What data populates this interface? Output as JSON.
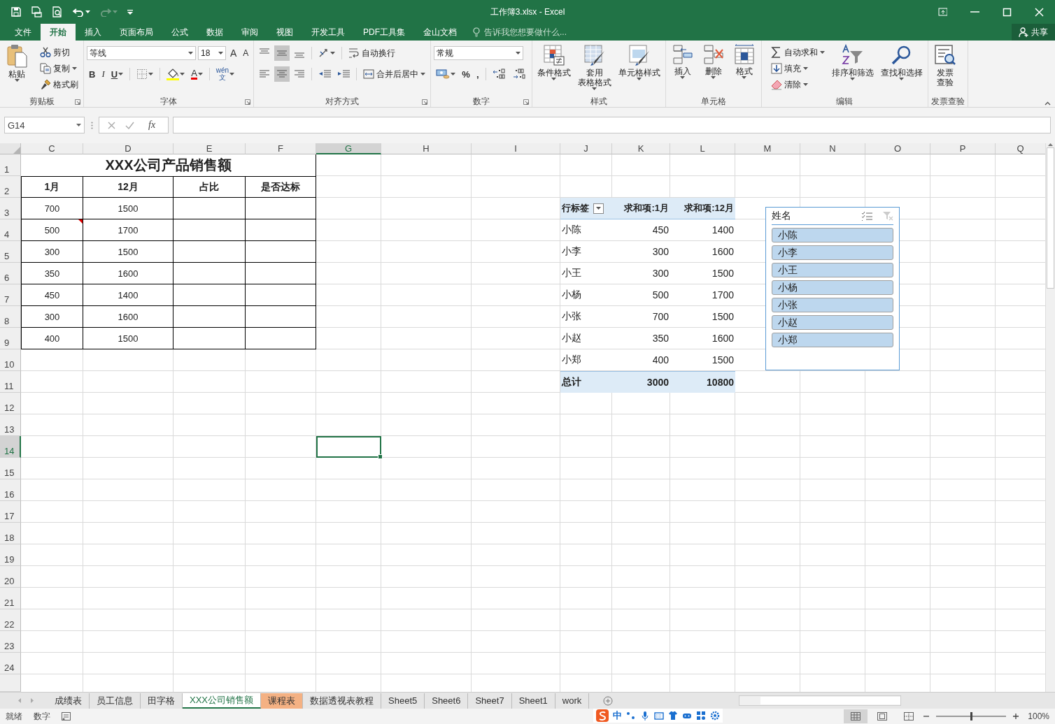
{
  "window": {
    "title": "工作簿3.xlsx - Excel"
  },
  "quick_access": {
    "redo_enabled": false
  },
  "menu_tabs": [
    {
      "label": "文件",
      "selected": false
    },
    {
      "label": "开始",
      "selected": true
    },
    {
      "label": "插入",
      "selected": false
    },
    {
      "label": "页面布局",
      "selected": false
    },
    {
      "label": "公式",
      "selected": false
    },
    {
      "label": "数据",
      "selected": false
    },
    {
      "label": "审阅",
      "selected": false
    },
    {
      "label": "视图",
      "selected": false
    },
    {
      "label": "开发工具",
      "selected": false
    },
    {
      "label": "PDF工具集",
      "selected": false
    },
    {
      "label": "金山文档",
      "selected": false
    }
  ],
  "tell_me": {
    "placeholder": "告诉我您想要做什么..."
  },
  "share": {
    "label": "共享"
  },
  "ribbon": {
    "groups": [
      {
        "label": "剪贴板",
        "launcher": true,
        "items": [
          {
            "kind": "large",
            "lines": [
              "粘贴"
            ],
            "dropdown": true
          },
          {
            "kind": "stack",
            "buttons": [
              {
                "label": "剪切",
                "dropdown": false
              },
              {
                "label": "复制",
                "dropdown": true
              },
              {
                "label": "格式刷",
                "dropdown": false
              }
            ]
          }
        ]
      },
      {
        "label": "字体",
        "launcher": true,
        "items": [
          {
            "kind": "lines",
            "lines": [
              [
                {
                  "kind": "font-name",
                  "value": "等线"
                },
                {
                  "kind": "font-size",
                  "value": "18"
                },
                {
                  "kind": "grow",
                  "label": "A"
                },
                {
                  "kind": "shrink",
                  "label": "A"
                }
              ],
              [
                {
                  "kind": "bold",
                  "label": "B"
                },
                {
                  "kind": "italic",
                  "label": "I"
                },
                {
                  "kind": "underline",
                  "label": "U",
                  "dropdown": true
                },
                {
                  "kind": "sep"
                },
                {
                  "kind": "icon",
                  "dropdown": true,
                  "selected": false
                },
                {
                  "kind": "sep"
                },
                {
                  "kind": "icon",
                  "dropdown": true,
                  "selected": false
                },
                {
                  "kind": "font-color",
                  "label": "A",
                  "dropdown": true
                },
                {
                  "kind": "sep"
                },
                {
                  "kind": "phonetic",
                  "top": "wén",
                  "bottom": "文",
                  "dropdown": true
                }
              ]
            ]
          }
        ]
      },
      {
        "label": "对齐方式",
        "launcher": true,
        "items": [
          {
            "kind": "lines",
            "lines": [
              [
                {
                  "kind": "icon",
                  "dropdown": false,
                  "selected": false
                },
                {
                  "kind": "icon",
                  "dropdown": false,
                  "selected": true
                },
                {
                  "kind": "icon",
                  "dropdown": false,
                  "selected": false
                },
                {
                  "kind": "sep"
                },
                {
                  "kind": "icon",
                  "dropdown": true,
                  "selected": false
                },
                {
                  "kind": "sep"
                },
                {
                  "kind": "labeled",
                  "label": "自动换行",
                  "dropdown": false
                }
              ],
              [
                {
                  "kind": "icon",
                  "dropdown": false,
                  "selected": false
                },
                {
                  "kind": "icon",
                  "dropdown": false,
                  "selected": true
                },
                {
                  "kind": "icon",
                  "dropdown": false,
                  "selected": false
                },
                {
                  "kind": "sep"
                },
                {
                  "kind": "icon",
                  "dropdown": false,
                  "selected": false
                },
                {
                  "kind": "icon",
                  "dropdown": false,
                  "selected": false
                },
                {
                  "kind": "sep"
                },
                {
                  "kind": "labeled",
                  "label": "合并后居中",
                  "dropdown": true
                }
              ]
            ]
          }
        ]
      },
      {
        "label": "数字",
        "launcher": true,
        "items": [
          {
            "kind": "lines",
            "lines": [
              [
                {
                  "kind": "number-format",
                  "value": "常规"
                }
              ],
              [
                {
                  "kind": "icon",
                  "dropdown": true,
                  "selected": false
                },
                {
                  "kind": "glyph",
                  "label": "%"
                },
                {
                  "kind": "glyph",
                  "label": ","
                },
                {
                  "kind": "sep"
                },
                {
                  "kind": "icon",
                  "dropdown": false,
                  "selected": false
                },
                {
                  "kind": "icon",
                  "dropdown": false,
                  "selected": false
                }
              ]
            ]
          }
        ]
      },
      {
        "label": "样式",
        "launcher": false,
        "items": [
          {
            "kind": "large",
            "lines": [
              "条件格式"
            ],
            "dropdown": true
          },
          {
            "kind": "large",
            "lines": [
              "套用",
              "表格格式"
            ],
            "dropdown": true
          },
          {
            "kind": "large",
            "lines": [
              "单元格样式"
            ],
            "dropdown": true
          }
        ]
      },
      {
        "label": "单元格",
        "launcher": false,
        "items": [
          {
            "kind": "large",
            "lines": [
              "插入"
            ],
            "dropdown": true
          },
          {
            "kind": "large",
            "lines": [
              "删除"
            ],
            "dropdown": true
          },
          {
            "kind": "large",
            "lines": [
              "格式"
            ],
            "dropdown": true
          }
        ]
      },
      {
        "label": "编辑",
        "launcher": false,
        "items": [
          {
            "kind": "stack",
            "buttons": [
              {
                "label": "自动求和",
                "dropdown": true
              },
              {
                "label": "填充",
                "dropdown": true
              },
              {
                "label": "清除",
                "dropdown": true
              }
            ]
          },
          {
            "kind": "large",
            "lines": [
              "排序和筛选"
            ],
            "dropdown": true
          },
          {
            "kind": "large",
            "lines": [
              "查找和选择"
            ],
            "dropdown": true
          }
        ]
      },
      {
        "label": "发票查验",
        "launcher": false,
        "items": [
          {
            "kind": "large",
            "lines": [
              "发票",
              "查验"
            ],
            "dropdown": false
          }
        ]
      }
    ]
  },
  "formula_bar": {
    "name_box": "G14",
    "function_label": "fx"
  },
  "sheet": {
    "columns": [
      {
        "label": "C",
        "selected": false
      },
      {
        "label": "D",
        "selected": false
      },
      {
        "label": "E",
        "selected": false
      },
      {
        "label": "F",
        "selected": false
      },
      {
        "label": "G",
        "selected": true
      },
      {
        "label": "H",
        "selected": false
      },
      {
        "label": "I",
        "selected": false
      },
      {
        "label": "J",
        "selected": false
      },
      {
        "label": "K",
        "selected": false
      },
      {
        "label": "L",
        "selected": false
      },
      {
        "label": "M",
        "selected": false
      },
      {
        "label": "N",
        "selected": false
      },
      {
        "label": "O",
        "selected": false
      },
      {
        "label": "P",
        "selected": false
      },
      {
        "label": "Q",
        "selected": false
      }
    ],
    "rows": [
      {
        "label": "1",
        "selected": false
      },
      {
        "label": "2",
        "selected": false
      },
      {
        "label": "3",
        "selected": false
      },
      {
        "label": "4",
        "selected": false
      },
      {
        "label": "5",
        "selected": false
      },
      {
        "label": "6",
        "selected": false
      },
      {
        "label": "7",
        "selected": false
      },
      {
        "label": "8",
        "selected": false
      },
      {
        "label": "9",
        "selected": false
      },
      {
        "label": "10",
        "selected": false
      },
      {
        "label": "11",
        "selected": false
      },
      {
        "label": "12",
        "selected": false
      },
      {
        "label": "13",
        "selected": false
      },
      {
        "label": "14",
        "selected": true
      },
      {
        "label": "15",
        "selected": false
      },
      {
        "label": "16",
        "selected": false
      },
      {
        "label": "17",
        "selected": false
      },
      {
        "label": "18",
        "selected": false
      },
      {
        "label": "19",
        "selected": false
      },
      {
        "label": "20",
        "selected": false
      },
      {
        "label": "21",
        "selected": false
      },
      {
        "label": "22",
        "selected": false
      },
      {
        "label": "23",
        "selected": false
      },
      {
        "label": "24",
        "selected": false
      }
    ],
    "sales_table": {
      "title": "XXX公司产品销售额",
      "headers": [
        "1月",
        "12月",
        "占比",
        "是否达标"
      ],
      "rows": [
        {
          "values": [
            "700",
            "1500"
          ],
          "comment": false
        },
        {
          "values": [
            "500",
            "1700"
          ],
          "comment": true
        },
        {
          "values": [
            "300",
            "1500"
          ],
          "comment": false
        },
        {
          "values": [
            "350",
            "1600"
          ],
          "comment": false
        },
        {
          "values": [
            "450",
            "1400"
          ],
          "comment": false
        },
        {
          "values": [
            "300",
            "1600"
          ],
          "comment": false
        },
        {
          "values": [
            "400",
            "1500"
          ],
          "comment": false
        }
      ]
    },
    "pivot": {
      "headers": [
        "行标签",
        "求和项:1月",
        "求和项:12月"
      ],
      "rows": [
        {
          "label": "小陈",
          "values": [
            "450",
            "1400"
          ]
        },
        {
          "label": "小李",
          "values": [
            "300",
            "1600"
          ]
        },
        {
          "label": "小王",
          "values": [
            "300",
            "1500"
          ]
        },
        {
          "label": "小杨",
          "values": [
            "500",
            "1700"
          ]
        },
        {
          "label": "小张",
          "values": [
            "700",
            "1500"
          ]
        },
        {
          "label": "小赵",
          "values": [
            "350",
            "1600"
          ]
        },
        {
          "label": "小郑",
          "values": [
            "400",
            "1500"
          ]
        }
      ],
      "total": {
        "label": "总计",
        "values": [
          "3000",
          "10800"
        ]
      }
    },
    "slicer": {
      "title": "姓名",
      "items": [
        {
          "label": "小陈",
          "selected": true
        },
        {
          "label": "小李",
          "selected": true
        },
        {
          "label": "小王",
          "selected": true
        },
        {
          "label": "小杨",
          "selected": true
        },
        {
          "label": "小张",
          "selected": true
        },
        {
          "label": "小赵",
          "selected": true
        },
        {
          "label": "小郑",
          "selected": true
        }
      ]
    }
  },
  "sheet_tabs": [
    {
      "label": "成绩表",
      "selected": false
    },
    {
      "label": "员工信息",
      "selected": false
    },
    {
      "label": "田字格",
      "selected": false
    },
    {
      "label": "XXX公司销售额",
      "selected": true
    },
    {
      "label": "课程表",
      "selected": false,
      "color": "#f4b183"
    },
    {
      "label": "数据透视表教程",
      "selected": false
    },
    {
      "label": "Sheet5",
      "selected": false
    },
    {
      "label": "Sheet6",
      "selected": false
    },
    {
      "label": "Sheet7",
      "selected": false
    },
    {
      "label": "Sheet1",
      "selected": false
    },
    {
      "label": "work",
      "selected": false
    }
  ],
  "status_bar": {
    "mode": "就绪",
    "num_mode": "数字",
    "views": [
      {
        "kind": "normal",
        "selected": true
      },
      {
        "kind": "page-layout",
        "selected": false
      },
      {
        "kind": "page-break",
        "selected": false
      }
    ],
    "zoom": {
      "level": 0.5,
      "label": "100%"
    }
  },
  "ime_toolbar": {
    "label": "中"
  }
}
